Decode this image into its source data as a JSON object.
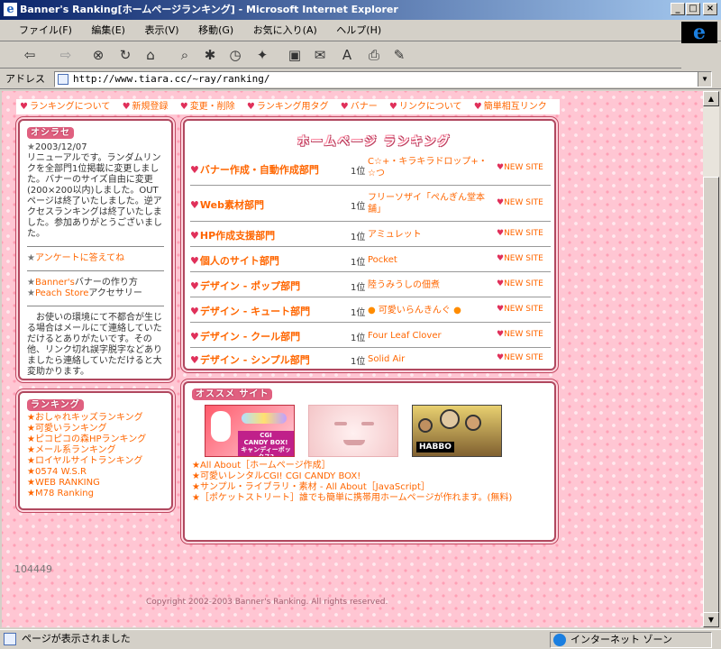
{
  "window": {
    "title": "Banner's Ranking[ホームページランキング] - Microsoft Internet Explorer",
    "controls": {
      "minimize": "_",
      "maximize": "□",
      "close": "×"
    }
  },
  "menu": [
    "ファイル(F)",
    "編集(E)",
    "表示(V)",
    "移動(G)",
    "お気に入り(A)",
    "ヘルプ(H)"
  ],
  "toolbar": {
    "icons": [
      "back-arrow-icon",
      "forward-arrow-icon",
      "stop-icon",
      "refresh-icon",
      "home-icon",
      "search-icon",
      "favorites-icon",
      "history-icon",
      "channels-icon",
      "fullscreen-icon",
      "mail-icon",
      "font-icon",
      "print-icon",
      "edit-icon"
    ]
  },
  "address": {
    "label": "アドレス",
    "url": "http://www.tiara.cc/~ray/ranking/"
  },
  "nav": [
    "ランキングについて",
    "新規登録",
    "変更・削除",
    "ランキング用タグ",
    "バナー",
    "リンクについて",
    "簡単相互リンク"
  ],
  "info_panel": {
    "title": "オシラセ",
    "date": "2003/12/07",
    "news": "リニューアルです。ランダムリンクを全部門1位掲載に変更しました。バナーのサイズ自由に変更(200×200以内)しました。OUTページは終了いたしました。逆アクセスランキングは終了いたしました。参加ありがとうございました。",
    "survey_link": "アンケートに答えてね",
    "links": [
      {
        "link": "Banner's",
        "text": "バナーの作り方"
      },
      {
        "link": "Peach Store",
        "text": "アクセサリー"
      }
    ],
    "notice": "お使いの環境にて不都合が生じる場合はメールにて連絡していただけるとありがたいです。その他、リンク切れ誤字脱字などありましたら連絡していただけると大変助かります。"
  },
  "ranking_links_panel": {
    "title": "ランキング",
    "items": [
      "おしゃれキッズランキング",
      "可愛いランキング",
      "ピコピコの森HPランキング",
      "メール系ランキング",
      "ロイヤルサイトランキング",
      "0574 W.S.R",
      "WEB RANKING",
      "M78 Ranking"
    ]
  },
  "main_ranking": {
    "title": "ホームページ ランキング",
    "rows": [
      {
        "category": "バナー作成・自動作成部門",
        "rank": "1位",
        "site": "C☆+・キラキラドロップ+・☆つ",
        "new": "NEW SITE"
      },
      {
        "category": "Web素材部門",
        "rank": "1位",
        "site": "フリーソザイ「ぺんぎん堂本舗」",
        "new": "NEW SITE"
      },
      {
        "category": "HP作成支援部門",
        "rank": "1位",
        "site": "アミュレット",
        "new": "NEW SITE"
      },
      {
        "category": "個人のサイト部門",
        "rank": "1位",
        "site": "Pocket",
        "new": "NEW SITE"
      },
      {
        "category": "デザイン - ポップ部門",
        "rank": "1位",
        "site": "陸うみうしの佃煮",
        "new": "NEW SITE"
      },
      {
        "category": "デザイン - キュート部門",
        "rank": "1位",
        "site": "可愛いらんきんぐ",
        "new": "NEW SITE"
      },
      {
        "category": "デザイン - クール部門",
        "rank": "1位",
        "site": "Four Leaf Clover",
        "new": "NEW SITE"
      },
      {
        "category": "デザイン - シンプル部門",
        "rank": "1位",
        "site": "Solid Air",
        "new": "NEW SITE"
      }
    ]
  },
  "recommended": {
    "title": "オススメ サイト",
    "banners": [
      {
        "line1": "CGI",
        "line2": "CANDY BOX!",
        "line3": "キャンディーボックス?"
      },
      {
        "line1": ""
      },
      {
        "line1": "HABBO"
      }
    ],
    "links": [
      "All About［ホームページ作成］",
      "可愛いレンタルCGI!  CGI CANDY BOX!",
      "サンプル・ライブラリ・素材  -  All About［JavaScript］",
      "［ポケットストリート］誰でも簡単に携帯用ホームページが作れます。(無料)"
    ]
  },
  "counter": "104449",
  "footer": "Copyright 2002-2003 Banner's Ranking. All rights reserved.",
  "status": {
    "text": "ページが表示されました",
    "zone": "インターネット ゾーン"
  }
}
